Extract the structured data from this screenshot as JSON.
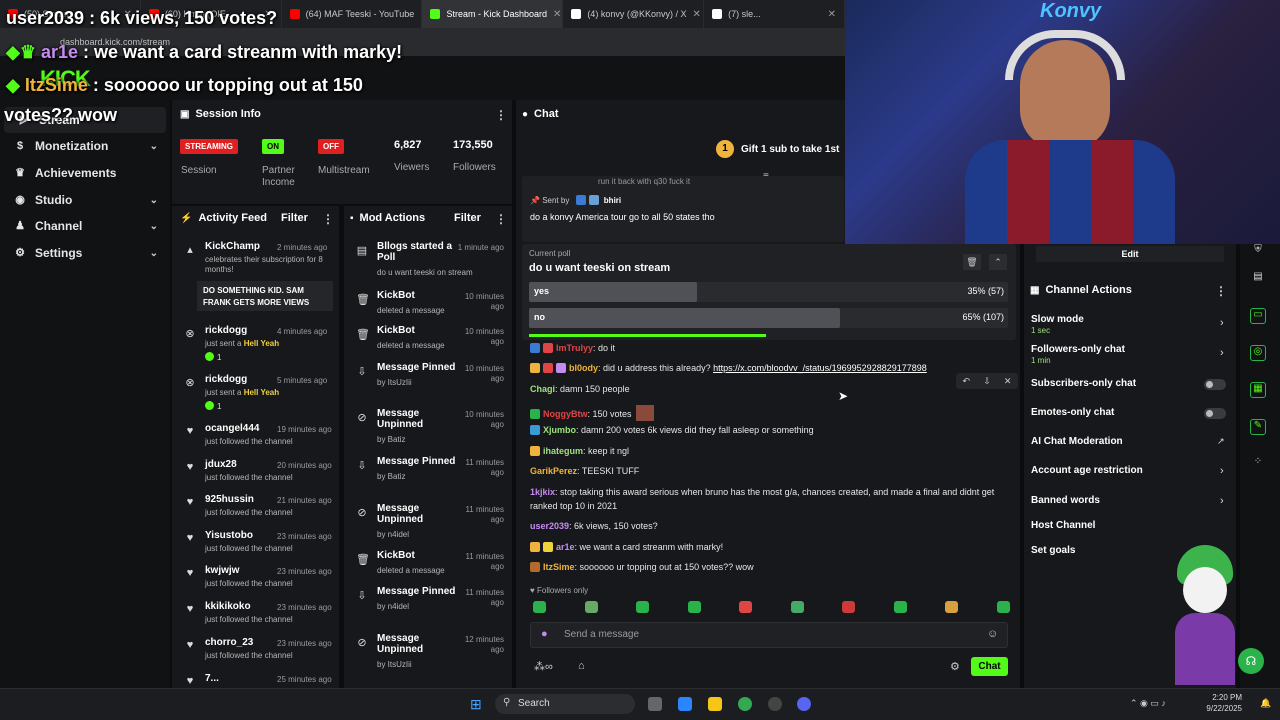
{
  "browser": {
    "tabs": [
      {
        "label": "(50) Stream...",
        "color": "#ff0000"
      },
      {
        "label": "(60) Hmm (OIE...",
        "color": "#ff0000"
      },
      {
        "label": "(64) MAF Teeski - YouTube",
        "color": "#ff0000"
      },
      {
        "label": "Stream - Kick Dashboard",
        "color": "#53fc18"
      },
      {
        "label": "(4) konvy (@KKonvy) / X",
        "color": "#ffffff"
      },
      {
        "label": "(7) sle...",
        "color": "#ffffff"
      }
    ],
    "address": "dashboard.kick.com/stream"
  },
  "overlay": {
    "line1": "user2039 : 6k views, 150 votes?",
    "line2_user": "ar1e",
    "line2_text": ": we want a card streanm with marky!",
    "line3_user": "ItzSime",
    "line3_text": ": soooooo ur topping out at 150",
    "line4": "votes?? wow"
  },
  "logo": "KICK",
  "sidebar": {
    "items": [
      {
        "label": "Stream",
        "icon": "stream-icon"
      },
      {
        "label": "Monetization",
        "icon": "dollar-icon"
      },
      {
        "label": "Achievements",
        "icon": "trophy-icon"
      },
      {
        "label": "Studio",
        "icon": "studio-icon"
      },
      {
        "label": "Channel",
        "icon": "user-icon"
      },
      {
        "label": "Settings",
        "icon": "gear-icon"
      }
    ]
  },
  "session": {
    "title": "Session Info",
    "streaming": "STREAMING",
    "session_label": "Session",
    "on": "ON",
    "partner_income": "Partner Income",
    "off": "OFF",
    "multistream": "Multistream",
    "viewers": "6,827",
    "viewers_label": "Viewers",
    "followers": "173,550",
    "followers_label": "Followers"
  },
  "activity": {
    "title": "Activity Feed",
    "filter": "Filter",
    "items": [
      {
        "name": "KickChamp",
        "time": "2 minutes ago",
        "sub": "celebrates their subscription for 8 months!",
        "quote": "DO SOMETHING KID. SAM FRANK GETS MORE VIEWS",
        "icon": "chevron-icon"
      },
      {
        "name": "rickdogg",
        "time": "4 minutes ago",
        "sub": "just sent a",
        "gift": "Hell Yeah",
        "count": "1",
        "icon": "kick-icon"
      },
      {
        "name": "rickdogg",
        "time": "5 minutes ago",
        "sub": "just sent a",
        "gift": "Hell Yeah",
        "count": "1",
        "icon": "kick-icon"
      },
      {
        "name": "ocangel444",
        "time": "19 minutes ago",
        "sub": "just followed the channel",
        "icon": "heart-icon"
      },
      {
        "name": "jdux28",
        "time": "20 minutes ago",
        "sub": "just followed the channel",
        "icon": "heart-icon"
      },
      {
        "name": "925hussin",
        "time": "21 minutes ago",
        "sub": "just followed the channel",
        "icon": "heart-icon"
      },
      {
        "name": "Yisustobo",
        "time": "23 minutes ago",
        "sub": "just followed the channel",
        "icon": "heart-icon"
      },
      {
        "name": "kwjwjw",
        "time": "23 minutes ago",
        "sub": "just followed the channel",
        "icon": "heart-icon"
      },
      {
        "name": "kkikikoko",
        "time": "23 minutes ago",
        "sub": "just followed the channel",
        "icon": "heart-icon"
      },
      {
        "name": "chorro_23",
        "time": "23 minutes ago",
        "sub": "just followed the channel",
        "icon": "heart-icon"
      },
      {
        "name": "7...",
        "time": "25 minutes ago",
        "sub": "",
        "icon": "heart-icon"
      }
    ]
  },
  "mod": {
    "title": "Mod Actions",
    "filter": "Filter",
    "items": [
      {
        "title": "Bllogs started a Poll",
        "sub": "do u want teeski on stream",
        "time": "1 minute ago",
        "icon": "poll-icon"
      },
      {
        "title": "KickBot",
        "sub": "deleted a message",
        "time": "10 minutes ago",
        "icon": "trash-icon"
      },
      {
        "title": "KickBot",
        "sub": "deleted a message",
        "time": "10 minutes ago",
        "icon": "trash-icon"
      },
      {
        "title": "Message Pinned",
        "sub": "by ItsUzIii",
        "time": "10 minutes ago",
        "icon": "pin-icon"
      },
      {
        "title": "Message Unpinned",
        "sub": "by Batiz",
        "time": "10 minutes ago",
        "icon": "unpin-icon"
      },
      {
        "title": "Message Pinned",
        "sub": "by Batiz",
        "time": "11 minutes ago",
        "icon": "pin-icon"
      },
      {
        "title": "Message Unpinned",
        "sub": "by n4idel",
        "time": "11 minutes ago",
        "icon": "unpin-icon"
      },
      {
        "title": "KickBot",
        "sub": "deleted a message",
        "time": "11 minutes ago",
        "icon": "trash-icon"
      },
      {
        "title": "Message Pinned",
        "sub": "by n4idel",
        "time": "11 minutes ago",
        "icon": "pin-icon"
      },
      {
        "title": "Message Unpinned",
        "sub": "by ItsUzIii",
        "time": "12 minutes ago",
        "icon": "unpin-icon"
      }
    ]
  },
  "chat": {
    "title": "Chat",
    "gift_count": "1",
    "gift_text": "Gift 1 sub to take 1st",
    "pinned_text_top": "run it back with q30 fuck it",
    "sent_by": "Sent by",
    "sent_by_user": "bhiri",
    "pinned_msg": "do a konvy America tour go to all 50 states tho",
    "poll_label": "Current poll",
    "poll_question": "do u want teeski on stream",
    "poll_options": [
      {
        "label": "yes",
        "value": "35% (57)",
        "fraction": 0.35
      },
      {
        "label": "no",
        "value": "65% (107)",
        "fraction": 0.65
      }
    ],
    "messages": [
      {
        "user": "ImTrulyy",
        "color": "#e04545",
        "text": ": do it"
      },
      {
        "user": "bl0ody",
        "color": "#f0b43c",
        "text": ": did u address this already? ",
        "link": "https://x.com/bloodvv_/status/1969952928829177898"
      },
      {
        "user": "Chagi",
        "color": "#9ee37d",
        "text": ": damn 150 people"
      },
      {
        "user": "NoggyBtw",
        "color": "#e04545",
        "text": ": 150 votes"
      },
      {
        "user": "Xjumbo",
        "color": "#9ee37d",
        "text": ": damn 200 votes 6k views did they fall asleep or something"
      },
      {
        "user": "ihategum",
        "color": "#9ee37d",
        "text": ": keep it ngl"
      },
      {
        "user": "GarikPerez",
        "color": "#f0b43c",
        "text": ": TEESKI TUFF"
      },
      {
        "user": "1kjkix",
        "color": "#c58cf0",
        "text": ": stop taking this award serious when bruno has the most g/a, chances created, and made a final and didnt get"
      },
      {
        "user": "",
        "color": "#e6e6e6",
        "text": "ranked top 10 in 2021"
      },
      {
        "user": "user2039",
        "color": "#c58cf0",
        "text": ": 6k views, 150 votes?"
      },
      {
        "user": "ar1e",
        "color": "#c58cf0",
        "text": ": we want a card streanm with marky!"
      },
      {
        "user": "ItzSime",
        "color": "#f0b43c",
        "text": ": soooooo ur topping out at 150 votes?? wow"
      }
    ],
    "followers_only": "Followers only",
    "input_placeholder": "Send a message",
    "send": "Chat"
  },
  "right": {
    "edit": "Edit",
    "actions_title": "Channel Actions",
    "actions": [
      {
        "label": "Slow mode",
        "sub": "1 sec",
        "kind": "chevron"
      },
      {
        "label": "Followers-only chat",
        "sub": "1 min",
        "kind": "chevron"
      },
      {
        "label": "Subscribers-only chat",
        "sub": "",
        "kind": "toggle"
      },
      {
        "label": "Emotes-only chat",
        "sub": "",
        "kind": "toggle"
      },
      {
        "label": "AI Chat Moderation",
        "sub": "",
        "kind": "external"
      },
      {
        "label": "Account age restriction",
        "sub": "",
        "kind": "chevron"
      },
      {
        "label": "Banned words",
        "sub": "",
        "kind": "chevron"
      },
      {
        "label": "Host Channel",
        "sub": "",
        "kind": "none"
      },
      {
        "label": "Set goals",
        "sub": "",
        "kind": "none"
      }
    ]
  },
  "taskbar": {
    "search": "Search",
    "time": "2:20 PM",
    "date": "9/22/2025"
  },
  "colors": {
    "kick_green": "#53fc18",
    "streaming_red": "#e02020",
    "panel": "#17181b"
  }
}
